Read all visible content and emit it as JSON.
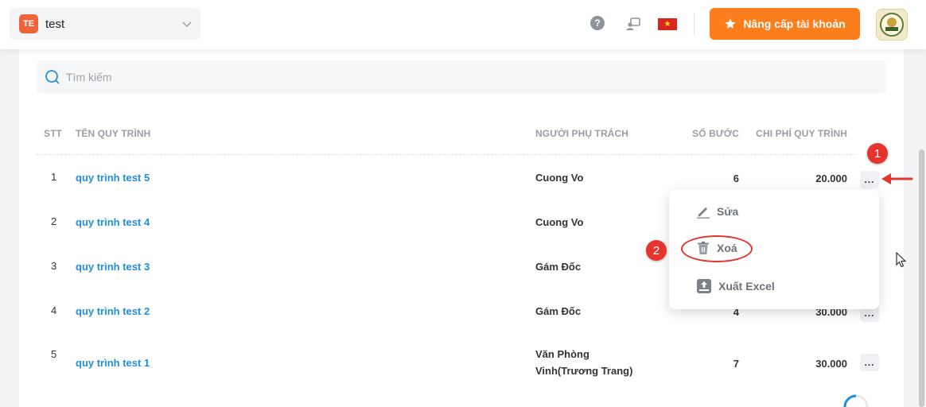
{
  "header": {
    "workspace": {
      "badge": "TE",
      "name": "test"
    },
    "upgrade_label": "Nâng cấp tài khoản",
    "colors": {
      "accent": "#fb7d1b",
      "badge": "#f0643c",
      "link": "#1f8fe0",
      "annotation": "#e5342c"
    }
  },
  "search": {
    "placeholder": "Tìm kiếm"
  },
  "table": {
    "columns": {
      "stt": "STT",
      "name": "TÊN QUY TRÌNH",
      "owner": "NGƯỜI PHỤ TRÁCH",
      "steps": "SỐ BƯỚC",
      "cost": "CHI PHÍ QUY TRÌNH"
    },
    "rows": [
      {
        "stt": "1",
        "name": "quy trình test 5",
        "owner": "Cuong Vo",
        "owner2": "",
        "steps": "6",
        "cost": "20.000"
      },
      {
        "stt": "2",
        "name": "quy trình test 4",
        "owner": "Cuong Vo",
        "owner2": "",
        "steps": "",
        "cost": ""
      },
      {
        "stt": "3",
        "name": "quy trình test 3",
        "owner": "Gám Đốc",
        "owner2": "",
        "steps": "",
        "cost": ""
      },
      {
        "stt": "4",
        "name": "quy trình test 2",
        "owner": "Gám Đốc",
        "owner2": "",
        "steps": "4",
        "cost": "30.000"
      },
      {
        "stt": "5",
        "name": "quy trình test 1",
        "owner": "Văn Phòng",
        "owner2": "Vinh(Trương Trang)",
        "steps": "7",
        "cost": "30.000"
      }
    ],
    "more_label": "..."
  },
  "menu": {
    "edit": "Sửa",
    "delete": "Xoá",
    "export": "Xuất Excel"
  },
  "annotations": {
    "one": "1",
    "two": "2"
  }
}
